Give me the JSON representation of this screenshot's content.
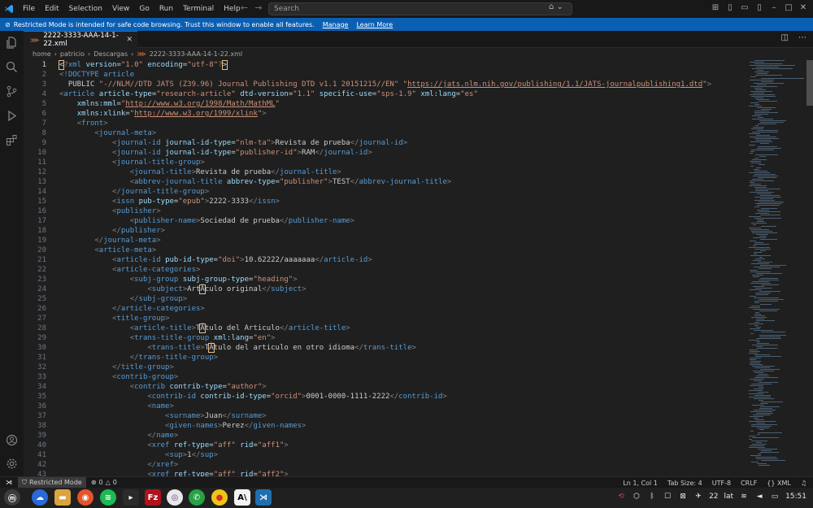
{
  "menu": {
    "file": "File",
    "edit": "Edit",
    "selection": "Selection",
    "view": "View",
    "go": "Go",
    "run": "Run",
    "terminal": "Terminal",
    "help": "Help"
  },
  "search": {
    "placeholder": "Search"
  },
  "banner": {
    "text": "Restricted Mode is intended for safe code browsing. Trust this window to enable all features.",
    "manage": "Manage",
    "learn_more": "Learn More"
  },
  "tab": {
    "filename": "2222-3333-AAA-14-1-22.xml"
  },
  "breadcrumb": {
    "items": [
      "home",
      "patricio",
      "Descargas",
      "2222-3333-AAA-14-1-22.xml"
    ]
  },
  "editor": {
    "lines": [
      {
        "n": "1",
        "html": "<span class=\"p\"><span class=\"hl\">&lt;</span>?</span><span class=\"t\">xml</span> <span class=\"a\">version</span>=<span class=\"v\">\"1.0\"</span> <span class=\"a\">encoding</span>=<span class=\"v\">\"utf-8\"</span><span class=\"p\">?<span class=\"hl\">&gt;</span></span>"
      },
      {
        "n": "2",
        "html": "<span class=\"p\">&lt;!</span><span class=\"d\">DOCTYPE</span> <span class=\"t\">article</span>"
      },
      {
        "n": "3",
        "html": "  PUBLIC <span class=\"v\">\"-//NLM//DTD JATS (Z39.96) Journal Publishing DTD v1.1 20151215//EN\"</span> <span class=\"v\">\"<span class=\"u\">https://jats.nlm.nih.gov/publishing/1.1/JATS-journalpublishing1.dtd</span>\"</span><span class=\"p\">&gt;</span>"
      },
      {
        "n": "4",
        "html": "<span class=\"p\">&lt;</span><span class=\"t\">article</span> <span class=\"a\">article-type</span>=<span class=\"v\">\"research-article\"</span> <span class=\"a\">dtd-version</span>=<span class=\"v\">\"1.1\"</span> <span class=\"a\">specific-use</span>=<span class=\"v\">\"sps-1.9\"</span> <span class=\"a\">xml:lang</span>=<span class=\"v\">\"es\"</span>"
      },
      {
        "n": "5",
        "html": "    <span class=\"a\">xmlns:mml</span>=<span class=\"v\">\"<span class=\"u\">http://www.w3.org/1998/Math/MathML</span>\"</span>"
      },
      {
        "n": "6",
        "html": "    <span class=\"a\">xmlns:xlink</span>=<span class=\"v\">\"<span class=\"u\">http://www.w3.org/1999/xlink</span>\"</span><span class=\"p\">&gt;</span>"
      },
      {
        "n": "7",
        "html": "    <span class=\"p\">&lt;</span><span class=\"t\">front</span><span class=\"p\">&gt;</span>"
      },
      {
        "n": "8",
        "html": "        <span class=\"p\">&lt;</span><span class=\"t\">journal-meta</span><span class=\"p\">&gt;</span>"
      },
      {
        "n": "9",
        "html": "            <span class=\"p\">&lt;</span><span class=\"t\">journal-id</span> <span class=\"a\">journal-id-type</span>=<span class=\"v\">\"nlm-ta\"</span><span class=\"p\">&gt;</span>Revista de prueba<span class=\"p\">&lt;/</span><span class=\"t\">journal-id</span><span class=\"p\">&gt;</span>"
      },
      {
        "n": "10",
        "html": "            <span class=\"p\">&lt;</span><span class=\"t\">journal-id</span> <span class=\"a\">journal-id-type</span>=<span class=\"v\">\"publisher-id\"</span><span class=\"p\">&gt;</span>RAM<span class=\"p\">&lt;/</span><span class=\"t\">journal-id</span><span class=\"p\">&gt;</span>"
      },
      {
        "n": "11",
        "html": "            <span class=\"p\">&lt;</span><span class=\"t\">journal-title-group</span><span class=\"p\">&gt;</span>"
      },
      {
        "n": "12",
        "html": "                <span class=\"p\">&lt;</span><span class=\"t\">journal-title</span><span class=\"p\">&gt;</span>Revista de prueba<span class=\"p\">&lt;/</span><span class=\"t\">journal-title</span><span class=\"p\">&gt;</span>"
      },
      {
        "n": "13",
        "html": "                <span class=\"p\">&lt;</span><span class=\"t\">abbrev-journal-title</span> <span class=\"a\">abbrev-type</span>=<span class=\"v\">\"publisher\"</span><span class=\"p\">&gt;</span>TEST<span class=\"p\">&lt;/</span><span class=\"t\">abbrev-journal-title</span><span class=\"p\">&gt;</span>"
      },
      {
        "n": "14",
        "html": "            <span class=\"p\">&lt;/</span><span class=\"t\">journal-title-group</span><span class=\"p\">&gt;</span>"
      },
      {
        "n": "15",
        "html": "            <span class=\"p\">&lt;</span><span class=\"t\">issn</span> <span class=\"a\">pub-type</span>=<span class=\"v\">\"epub\"</span><span class=\"p\">&gt;</span>2222-3333<span class=\"p\">&lt;/</span><span class=\"t\">issn</span><span class=\"p\">&gt;</span>"
      },
      {
        "n": "16",
        "html": "            <span class=\"p\">&lt;</span><span class=\"t\">publisher</span><span class=\"p\">&gt;</span>"
      },
      {
        "n": "17",
        "html": "                <span class=\"p\">&lt;</span><span class=\"t\">publisher-name</span><span class=\"p\">&gt;</span>Sociedad de prueba<span class=\"p\">&lt;/</span><span class=\"t\">publisher-name</span><span class=\"p\">&gt;</span>"
      },
      {
        "n": "18",
        "html": "            <span class=\"p\">&lt;/</span><span class=\"t\">publisher</span><span class=\"p\">&gt;</span>"
      },
      {
        "n": "19",
        "html": "        <span class=\"p\">&lt;/</span><span class=\"t\">journal-meta</span><span class=\"p\">&gt;</span>"
      },
      {
        "n": "20",
        "html": "        <span class=\"p\">&lt;</span><span class=\"t\">article-meta</span><span class=\"p\">&gt;</span>"
      },
      {
        "n": "21",
        "html": "            <span class=\"p\">&lt;</span><span class=\"t\">article-id</span> <span class=\"a\">pub-id-type</span>=<span class=\"v\">\"doi\"</span><span class=\"p\">&gt;</span>10.62222/aaaaaaa<span class=\"p\">&lt;/</span><span class=\"t\">article-id</span><span class=\"p\">&gt;</span>"
      },
      {
        "n": "22",
        "html": "            <span class=\"p\">&lt;</span><span class=\"t\">article-categories</span><span class=\"p\">&gt;</span>"
      },
      {
        "n": "23",
        "html": "                <span class=\"p\">&lt;</span><span class=\"t\">subj-group</span> <span class=\"a\">subj-group-type</span>=<span class=\"v\">\"heading\"</span><span class=\"p\">&gt;</span>"
      },
      {
        "n": "24",
        "html": "                    <span class=\"p\">&lt;</span><span class=\"t\">subject</span><span class=\"p\">&gt;</span>Art<span class=\"hl\">Ã</span>culo original<span class=\"p\">&lt;/</span><span class=\"t\">subject</span><span class=\"p\">&gt;</span>"
      },
      {
        "n": "25",
        "html": "                <span class=\"p\">&lt;/</span><span class=\"t\">subj-group</span><span class=\"p\">&gt;</span>"
      },
      {
        "n": "26",
        "html": "            <span class=\"p\">&lt;/</span><span class=\"t\">article-categories</span><span class=\"p\">&gt;</span>"
      },
      {
        "n": "27",
        "html": "            <span class=\"p\">&lt;</span><span class=\"t\">title-group</span><span class=\"p\">&gt;</span>"
      },
      {
        "n": "28",
        "html": "                <span class=\"p\">&lt;</span><span class=\"t\">article-title</span><span class=\"p\">&gt;</span>T<span class=\"hl\">Ã</span>tulo del Articulo<span class=\"p\">&lt;/</span><span class=\"t\">article-title</span><span class=\"p\">&gt;</span>"
      },
      {
        "n": "29",
        "html": "                <span class=\"p\">&lt;</span><span class=\"t\">trans-title-group</span> <span class=\"a\">xml:lang</span>=<span class=\"v\">\"en\"</span><span class=\"p\">&gt;</span>"
      },
      {
        "n": "30",
        "html": "                    <span class=\"p\">&lt;</span><span class=\"t\">trans-title</span><span class=\"p\">&gt;</span>T<span class=\"hl\">Ã</span>tulo del articulo en otro idioma<span class=\"p\">&lt;/</span><span class=\"t\">trans-title</span><span class=\"p\">&gt;</span>"
      },
      {
        "n": "31",
        "html": "                <span class=\"p\">&lt;/</span><span class=\"t\">trans-title-group</span><span class=\"p\">&gt;</span>"
      },
      {
        "n": "32",
        "html": "            <span class=\"p\">&lt;/</span><span class=\"t\">title-group</span><span class=\"p\">&gt;</span>"
      },
      {
        "n": "33",
        "html": "            <span class=\"p\">&lt;</span><span class=\"t\">contrib-group</span><span class=\"p\">&gt;</span>"
      },
      {
        "n": "34",
        "html": "                <span class=\"p\">&lt;</span><span class=\"t\">contrib</span> <span class=\"a\">contrib-type</span>=<span class=\"v\">\"author\"</span><span class=\"p\">&gt;</span>"
      },
      {
        "n": "35",
        "html": "                    <span class=\"p\">&lt;</span><span class=\"t\">contrib-id</span> <span class=\"a\">contrib-id-type</span>=<span class=\"v\">\"orcid\"</span><span class=\"p\">&gt;</span>0001-0000-1111-2222<span class=\"p\">&lt;/</span><span class=\"t\">contrib-id</span><span class=\"p\">&gt;</span>"
      },
      {
        "n": "36",
        "html": "                    <span class=\"p\">&lt;</span><span class=\"t\">name</span><span class=\"p\">&gt;</span>"
      },
      {
        "n": "37",
        "html": "                        <span class=\"p\">&lt;</span><span class=\"t\">surname</span><span class=\"p\">&gt;</span>Juan<span class=\"p\">&lt;/</span><span class=\"t\">surname</span><span class=\"p\">&gt;</span>"
      },
      {
        "n": "38",
        "html": "                        <span class=\"p\">&lt;</span><span class=\"t\">given-names</span><span class=\"p\">&gt;</span>Perez<span class=\"p\">&lt;/</span><span class=\"t\">given-names</span><span class=\"p\">&gt;</span>"
      },
      {
        "n": "39",
        "html": "                    <span class=\"p\">&lt;/</span><span class=\"t\">name</span><span class=\"p\">&gt;</span>"
      },
      {
        "n": "40",
        "html": "                    <span class=\"p\">&lt;</span><span class=\"t\">xref</span> <span class=\"a\">ref-type</span>=<span class=\"v\">\"aff\"</span> <span class=\"a\">rid</span>=<span class=\"v\">\"aff1\"</span><span class=\"p\">&gt;</span>"
      },
      {
        "n": "41",
        "html": "                        <span class=\"p\">&lt;</span><span class=\"t\">sup</span><span class=\"p\">&gt;</span>1<span class=\"p\">&lt;/</span><span class=\"t\">sup</span><span class=\"p\">&gt;</span>"
      },
      {
        "n": "42",
        "html": "                    <span class=\"p\">&lt;/</span><span class=\"t\">xref</span><span class=\"p\">&gt;</span>"
      },
      {
        "n": "43",
        "html": "                    <span class=\"p\">&lt;</span><span class=\"t\">xref</span> <span class=\"a\">ref-type</span>=<span class=\"v\">\"aff\"</span> <span class=\"a\">rid</span>=<span class=\"v\">\"aff2\"</span><span class=\"p\">&gt;</span>"
      }
    ]
  },
  "status": {
    "restricted": "Restricted Mode",
    "errors": "0",
    "warnings": "0",
    "position": "Ln 1, Col 1",
    "tab_size": "Tab Size: 4",
    "encoding": "UTF-8",
    "eol": "CRLF",
    "language": "XML"
  },
  "tray": {
    "temperature": "22",
    "keyboard": "lat",
    "time": "15:51"
  },
  "colors": {
    "accent": "#0078d4",
    "banner": "#0b5fb3",
    "tag": "#569cd6",
    "attr": "#9cdcfe",
    "string": "#ce9178"
  },
  "icons": [
    "vscode-logo",
    "explorer-icon",
    "search-icon",
    "source-control-icon",
    "run-debug-icon",
    "extensions-icon",
    "account-icon",
    "settings-gear-icon"
  ]
}
